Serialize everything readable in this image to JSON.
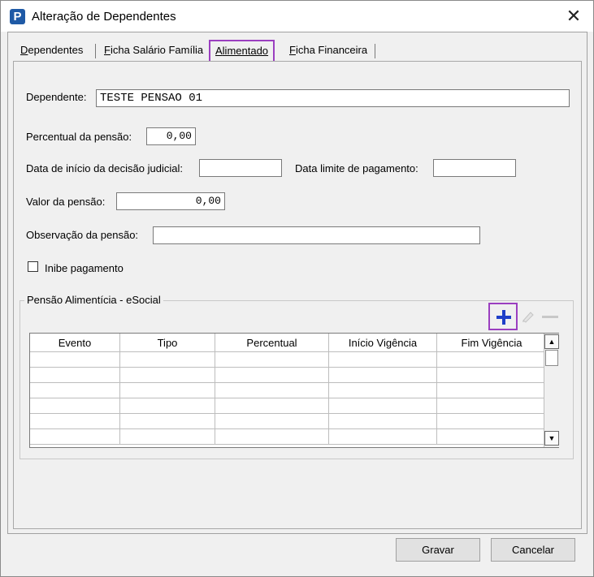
{
  "window": {
    "title": "Alteração de Dependentes",
    "app_icon_letter": "P"
  },
  "tabs": [
    {
      "label": "Dependentes",
      "mnemonic": "D",
      "rest": "ependentes"
    },
    {
      "label": "Ficha Salário Família",
      "mnemonic": "F",
      "rest": "icha Salário Família"
    },
    {
      "label": "Alimentado",
      "mnemonic": "A",
      "rest": "limentado",
      "active": true
    },
    {
      "label": "Ficha Financeira",
      "mnemonic": "F",
      "rest": "icha Financeira"
    }
  ],
  "form": {
    "dependente_label": "Dependente:",
    "dependente_value": "TESTE PENSAO 01",
    "percentual_label": "Percentual da pensão:",
    "percentual_value": "0,00",
    "data_inicio_label": "Data de início da decisão judicial:",
    "data_inicio_value": "",
    "data_limite_label": "Data limite de pagamento:",
    "data_limite_value": "",
    "valor_label": "Valor da pensão:",
    "valor_value": "0,00",
    "observacao_label": "Observação da pensão:",
    "observacao_value": "",
    "inibe_label": "Inibe pagamento",
    "inibe_checked": false
  },
  "esocial": {
    "group_title": "Pensão Alimentícia - eSocial",
    "columns": [
      "Evento",
      "Tipo",
      "Percentual",
      "Início Vigência",
      "Fim Vigência"
    ],
    "rows": [],
    "icons": {
      "add": "plus-icon",
      "edit": "pencil-icon",
      "remove": "minus-icon"
    }
  },
  "buttons": {
    "save": "Gravar",
    "cancel": "Cancelar"
  },
  "colors": {
    "highlight": "#9b3fc0",
    "add_icon": "#1f3fc8",
    "app_icon": "#1f5aa6"
  }
}
